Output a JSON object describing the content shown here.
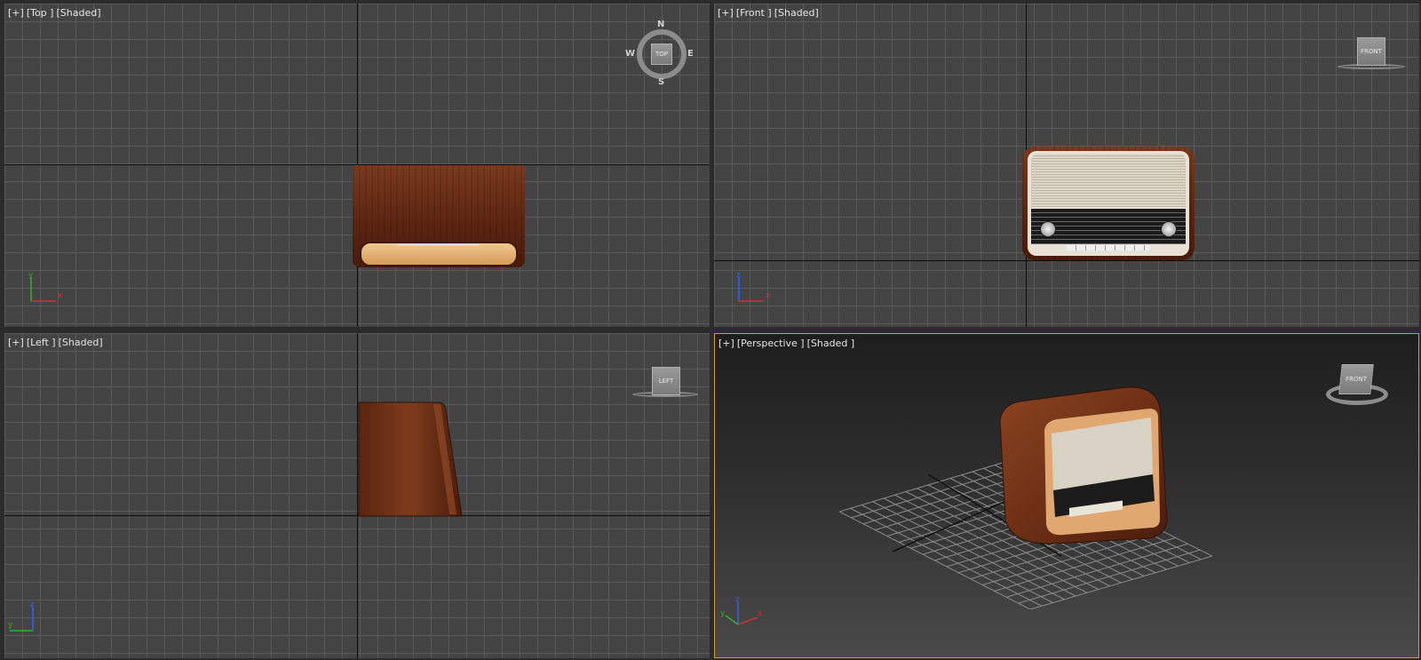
{
  "viewports": {
    "top": {
      "plus": "[+]",
      "view": "[Top ]",
      "mode": "[Shaded]",
      "viewcube": {
        "face": "TOP",
        "north": "N",
        "south": "S",
        "east": "E",
        "west": "W"
      },
      "axes": {
        "a": "y",
        "b": "x"
      }
    },
    "front": {
      "plus": "[+]",
      "view": "[Front ]",
      "mode": "[Shaded]",
      "viewcube": {
        "face": "FRONT"
      },
      "axes": {
        "a": "z",
        "b": "x"
      }
    },
    "left": {
      "plus": "[+]",
      "view": "[Left ]",
      "mode": "[Shaded]",
      "viewcube": {
        "face": "LEFT"
      },
      "axes": {
        "a": "z",
        "b": "y"
      }
    },
    "persp": {
      "plus": "[+]",
      "view": "[Perspective ]",
      "mode": "[Shaded ]",
      "viewcube": {
        "face": "FRONT"
      },
      "axes": {
        "a": "z",
        "b": "x",
        "c": "y"
      }
    }
  },
  "colors": {
    "active_border": "#c8a040",
    "axis_x": "#d03030",
    "axis_y": "#30b030",
    "axis_z": "#3060ff"
  }
}
